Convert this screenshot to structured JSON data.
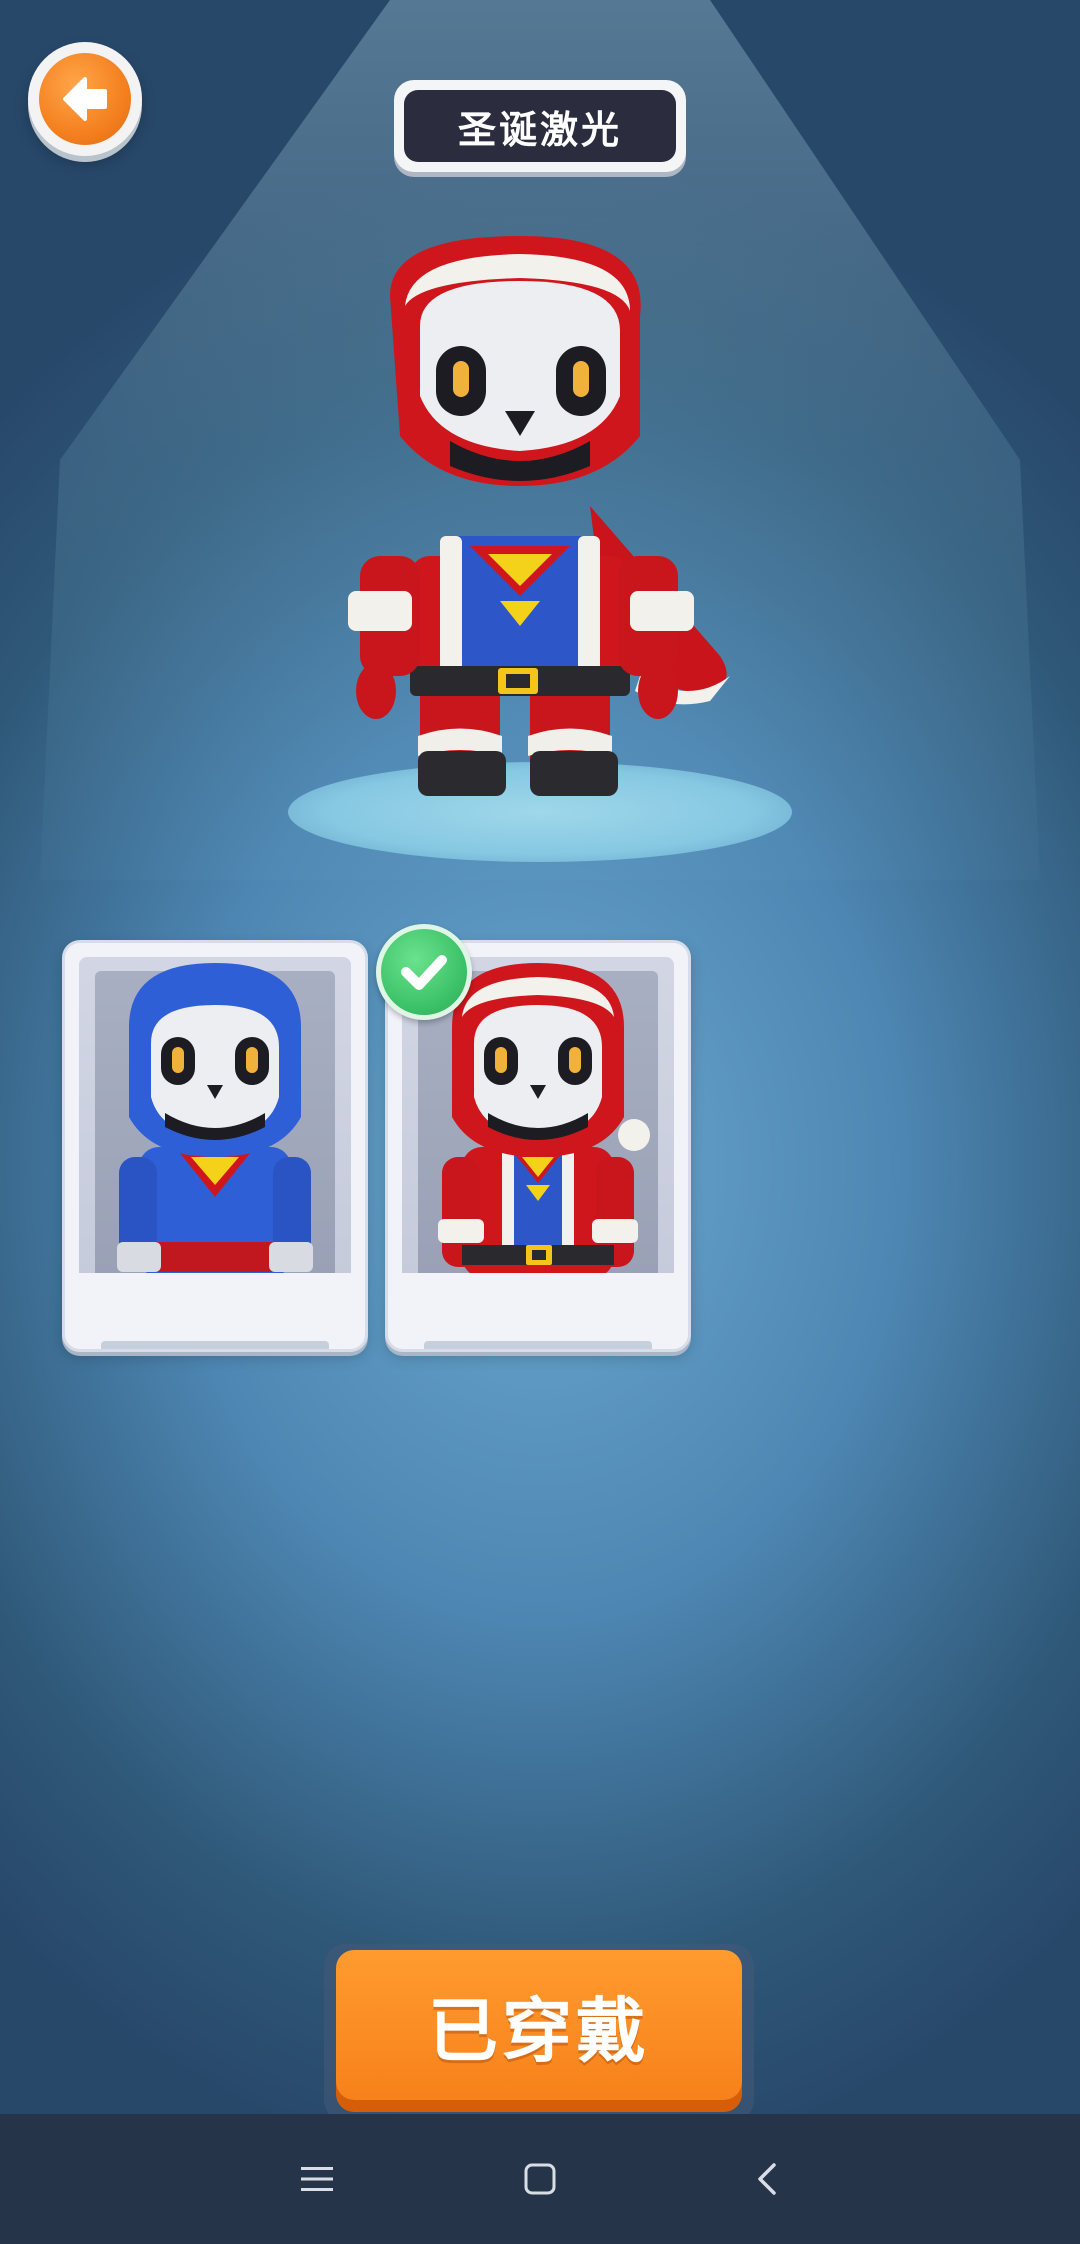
{
  "header": {
    "title": "圣诞激光"
  },
  "skins": [
    {
      "name": "blue-hooded-skeleton",
      "selected": false,
      "colors": {
        "primary": "#2f5fd6",
        "accent": "#f4d21a"
      }
    },
    {
      "name": "santa-skeleton",
      "selected": true,
      "colors": {
        "primary": "#d8191e",
        "accent": "#f4d21a"
      }
    }
  ],
  "action": {
    "equip_label": "已穿戴"
  },
  "icons": {
    "back": "arrow-left-icon",
    "selected": "checkmark-icon",
    "nav_menu": "menu-icon",
    "nav_home": "square-icon",
    "nav_back": "chevron-left-icon"
  },
  "colors": {
    "accent": "#f7811a",
    "selected_badge": "#3fc46a",
    "title_plate": "#2b2c3d"
  }
}
